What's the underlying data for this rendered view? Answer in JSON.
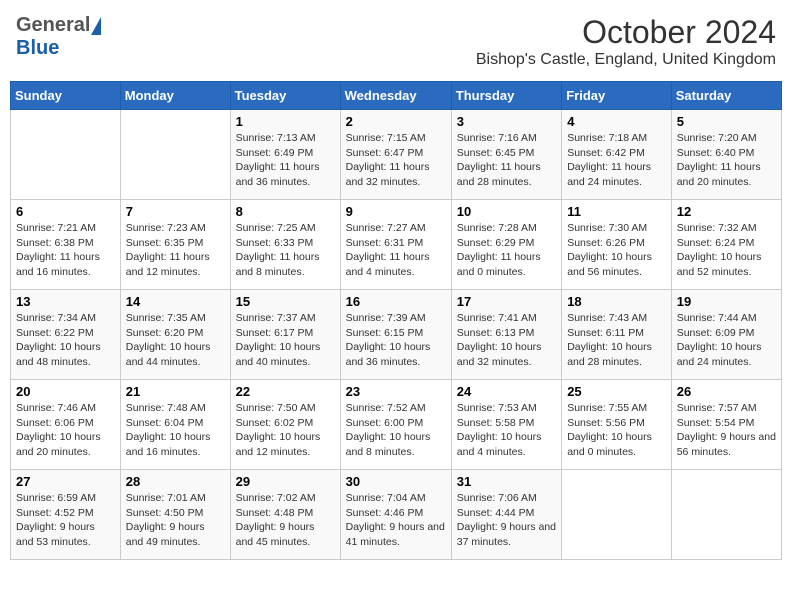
{
  "header": {
    "logo_general": "General",
    "logo_blue": "Blue",
    "title": "October 2024",
    "location": "Bishop's Castle, England, United Kingdom"
  },
  "days_of_week": [
    "Sunday",
    "Monday",
    "Tuesday",
    "Wednesday",
    "Thursday",
    "Friday",
    "Saturday"
  ],
  "weeks": [
    [
      {
        "day": "",
        "content": ""
      },
      {
        "day": "",
        "content": ""
      },
      {
        "day": "1",
        "content": "Sunrise: 7:13 AM\nSunset: 6:49 PM\nDaylight: 11 hours and 36 minutes."
      },
      {
        "day": "2",
        "content": "Sunrise: 7:15 AM\nSunset: 6:47 PM\nDaylight: 11 hours and 32 minutes."
      },
      {
        "day": "3",
        "content": "Sunrise: 7:16 AM\nSunset: 6:45 PM\nDaylight: 11 hours and 28 minutes."
      },
      {
        "day": "4",
        "content": "Sunrise: 7:18 AM\nSunset: 6:42 PM\nDaylight: 11 hours and 24 minutes."
      },
      {
        "day": "5",
        "content": "Sunrise: 7:20 AM\nSunset: 6:40 PM\nDaylight: 11 hours and 20 minutes."
      }
    ],
    [
      {
        "day": "6",
        "content": "Sunrise: 7:21 AM\nSunset: 6:38 PM\nDaylight: 11 hours and 16 minutes."
      },
      {
        "day": "7",
        "content": "Sunrise: 7:23 AM\nSunset: 6:35 PM\nDaylight: 11 hours and 12 minutes."
      },
      {
        "day": "8",
        "content": "Sunrise: 7:25 AM\nSunset: 6:33 PM\nDaylight: 11 hours and 8 minutes."
      },
      {
        "day": "9",
        "content": "Sunrise: 7:27 AM\nSunset: 6:31 PM\nDaylight: 11 hours and 4 minutes."
      },
      {
        "day": "10",
        "content": "Sunrise: 7:28 AM\nSunset: 6:29 PM\nDaylight: 11 hours and 0 minutes."
      },
      {
        "day": "11",
        "content": "Sunrise: 7:30 AM\nSunset: 6:26 PM\nDaylight: 10 hours and 56 minutes."
      },
      {
        "day": "12",
        "content": "Sunrise: 7:32 AM\nSunset: 6:24 PM\nDaylight: 10 hours and 52 minutes."
      }
    ],
    [
      {
        "day": "13",
        "content": "Sunrise: 7:34 AM\nSunset: 6:22 PM\nDaylight: 10 hours and 48 minutes."
      },
      {
        "day": "14",
        "content": "Sunrise: 7:35 AM\nSunset: 6:20 PM\nDaylight: 10 hours and 44 minutes."
      },
      {
        "day": "15",
        "content": "Sunrise: 7:37 AM\nSunset: 6:17 PM\nDaylight: 10 hours and 40 minutes."
      },
      {
        "day": "16",
        "content": "Sunrise: 7:39 AM\nSunset: 6:15 PM\nDaylight: 10 hours and 36 minutes."
      },
      {
        "day": "17",
        "content": "Sunrise: 7:41 AM\nSunset: 6:13 PM\nDaylight: 10 hours and 32 minutes."
      },
      {
        "day": "18",
        "content": "Sunrise: 7:43 AM\nSunset: 6:11 PM\nDaylight: 10 hours and 28 minutes."
      },
      {
        "day": "19",
        "content": "Sunrise: 7:44 AM\nSunset: 6:09 PM\nDaylight: 10 hours and 24 minutes."
      }
    ],
    [
      {
        "day": "20",
        "content": "Sunrise: 7:46 AM\nSunset: 6:06 PM\nDaylight: 10 hours and 20 minutes."
      },
      {
        "day": "21",
        "content": "Sunrise: 7:48 AM\nSunset: 6:04 PM\nDaylight: 10 hours and 16 minutes."
      },
      {
        "day": "22",
        "content": "Sunrise: 7:50 AM\nSunset: 6:02 PM\nDaylight: 10 hours and 12 minutes."
      },
      {
        "day": "23",
        "content": "Sunrise: 7:52 AM\nSunset: 6:00 PM\nDaylight: 10 hours and 8 minutes."
      },
      {
        "day": "24",
        "content": "Sunrise: 7:53 AM\nSunset: 5:58 PM\nDaylight: 10 hours and 4 minutes."
      },
      {
        "day": "25",
        "content": "Sunrise: 7:55 AM\nSunset: 5:56 PM\nDaylight: 10 hours and 0 minutes."
      },
      {
        "day": "26",
        "content": "Sunrise: 7:57 AM\nSunset: 5:54 PM\nDaylight: 9 hours and 56 minutes."
      }
    ],
    [
      {
        "day": "27",
        "content": "Sunrise: 6:59 AM\nSunset: 4:52 PM\nDaylight: 9 hours and 53 minutes."
      },
      {
        "day": "28",
        "content": "Sunrise: 7:01 AM\nSunset: 4:50 PM\nDaylight: 9 hours and 49 minutes."
      },
      {
        "day": "29",
        "content": "Sunrise: 7:02 AM\nSunset: 4:48 PM\nDaylight: 9 hours and 45 minutes."
      },
      {
        "day": "30",
        "content": "Sunrise: 7:04 AM\nSunset: 4:46 PM\nDaylight: 9 hours and 41 minutes."
      },
      {
        "day": "31",
        "content": "Sunrise: 7:06 AM\nSunset: 4:44 PM\nDaylight: 9 hours and 37 minutes."
      },
      {
        "day": "",
        "content": ""
      },
      {
        "day": "",
        "content": ""
      }
    ]
  ]
}
